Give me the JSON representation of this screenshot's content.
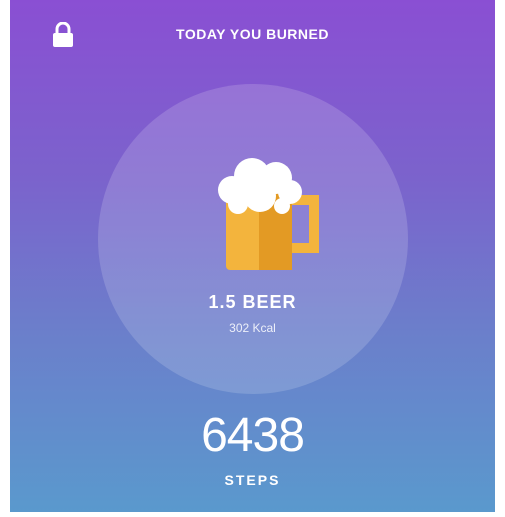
{
  "header": {
    "title": "TODAY YOU BURNED",
    "lock_icon": "lock-icon"
  },
  "summary": {
    "icon": "beer-mug-icon",
    "amount": "1.5 BEER",
    "kcal": "302 Kcal"
  },
  "steps": {
    "count": "6438",
    "label": "STEPS"
  },
  "colors": {
    "gradient_top": "#8a4fd3",
    "gradient_bottom": "#5a99cd",
    "beer": "#f3b43d",
    "beer_shadow": "#e39a24",
    "foam": "#ffffff"
  }
}
